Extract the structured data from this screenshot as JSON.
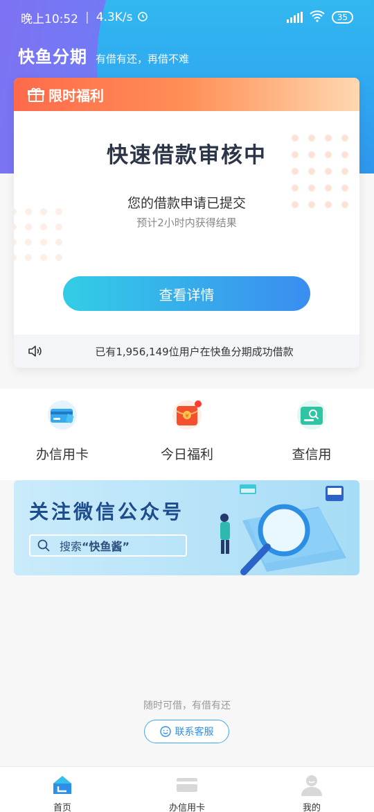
{
  "status_bar": {
    "time": "晚上10:52",
    "speed": "4.3K/s",
    "battery": "35"
  },
  "header": {
    "title": "快鱼分期",
    "slogan": "有借有还，再借不难"
  },
  "card": {
    "ribbon_label": "限时福利",
    "heading": "快速借款审核中",
    "line1": "您的借款申请已提交",
    "line2": "预计2小时内获得结果",
    "button_label": "查看详情",
    "notice": "已有1,956,149位用户在快鱼分期成功借款"
  },
  "quick_entries": [
    {
      "label": "办信用卡",
      "icon": "credit-card-icon"
    },
    {
      "label": "今日福利",
      "icon": "red-envelope-icon"
    },
    {
      "label": "查信用",
      "icon": "credit-check-icon"
    }
  ],
  "banner": {
    "title": "关注微信公众号",
    "search_prefix": "搜索",
    "search_keyword": "“快鱼酱”"
  },
  "footer": {
    "slogan": "随时可借，有借有还",
    "service_button": "联系客服"
  },
  "tabbar": [
    {
      "label": "首页",
      "icon": "home-icon",
      "active": true
    },
    {
      "label": "办信用卡",
      "icon": "card-icon",
      "active": false
    },
    {
      "label": "我的",
      "icon": "user-icon",
      "active": false
    }
  ],
  "colors": {
    "accent_blue": "#3a8df0",
    "ribbon_orange": "#ff6a4a",
    "banner_title": "#1d4b8c"
  }
}
